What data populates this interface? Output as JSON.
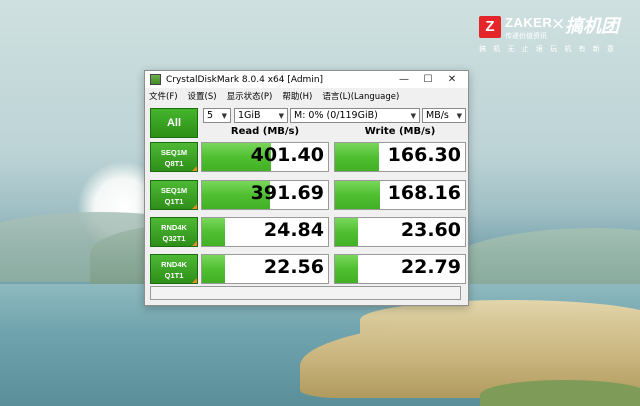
{
  "logo": {
    "z_letter": "Z",
    "brand": "ZAKER",
    "brand_sub": "传递价值资讯",
    "times": "×",
    "partner": "搞机团",
    "tagline": "搞 机 无 止 境   玩 机 有 新 意"
  },
  "window": {
    "title": "CrystalDiskMark 8.0.4 x64 [Admin]",
    "controls": {
      "minimize": "—",
      "maximize": "☐",
      "close": "✕"
    }
  },
  "menu": [
    "文件(F)",
    "设置(S)",
    "显示状态(P)",
    "帮助(H)",
    "语言(L)(Language)"
  ],
  "toolbar": {
    "all_label": "All",
    "count": "5",
    "size": "1GiB",
    "drive": "M: 0% (0/119GiB)",
    "unit": "MB/s"
  },
  "headers": {
    "read": "Read (MB/s)",
    "write": "Write (MB/s)"
  },
  "rows": [
    {
      "line1": "SEQ1M",
      "line2": "Q8T1",
      "read": "401.40",
      "write": "166.30",
      "read_fill": 0.55,
      "write_fill": 0.34
    },
    {
      "line1": "SEQ1M",
      "line2": "Q1T1",
      "read": "391.69",
      "write": "168.16",
      "read_fill": 0.54,
      "write_fill": 0.345
    },
    {
      "line1": "RND4K",
      "line2": "Q32T1",
      "read": "24.84",
      "write": "23.60",
      "read_fill": 0.18,
      "write_fill": 0.18
    },
    {
      "line1": "RND4K",
      "line2": "Q1T1",
      "read": "22.56",
      "write": "22.79",
      "read_fill": 0.18,
      "write_fill": 0.18
    }
  ],
  "status_text": ""
}
